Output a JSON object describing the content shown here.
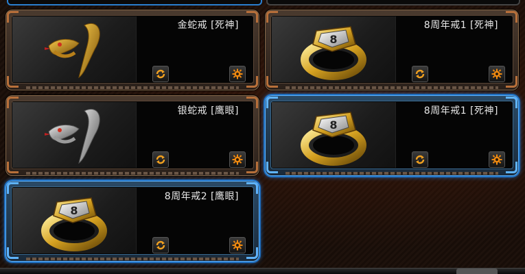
{
  "items": [
    {
      "name": "金蛇戒 [死神]",
      "icon": "gold-snake-ring-icon",
      "selected": false
    },
    {
      "name": "8周年戒1 [死神]",
      "icon": "anniversary-ring-icon",
      "selected": false
    },
    {
      "name": "银蛇戒 [鹰眼]",
      "icon": "silver-snake-ring-icon",
      "selected": false
    },
    {
      "name": "8周年戒1 [死神]",
      "icon": "anniversary-ring-icon",
      "selected": true
    },
    {
      "name": "8周年戒2 [鹰眼]",
      "icon": "anniversary-ring-icon",
      "selected": true
    }
  ],
  "colors": {
    "selected_border": "#5fb4ff",
    "frame_bronze": "#b8703a",
    "refresh_accent": "#f0a020",
    "settings_accent": "#f08a10"
  }
}
